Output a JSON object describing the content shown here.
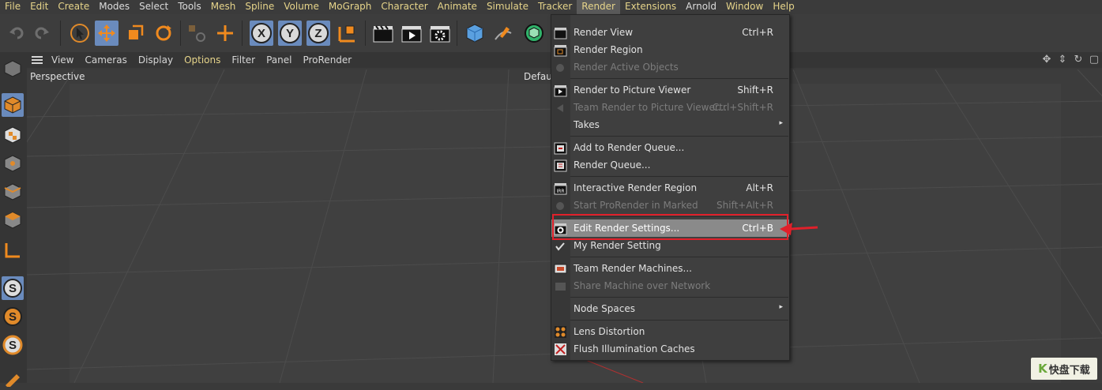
{
  "menubar": {
    "items": [
      {
        "label": "File"
      },
      {
        "label": "Edit"
      },
      {
        "label": "Create"
      },
      {
        "label": "Modes"
      },
      {
        "label": "Select"
      },
      {
        "label": "Tools"
      },
      {
        "label": "Mesh"
      },
      {
        "label": "Spline"
      },
      {
        "label": "Volume"
      },
      {
        "label": "MoGraph"
      },
      {
        "label": "Character"
      },
      {
        "label": "Animate"
      },
      {
        "label": "Simulate"
      },
      {
        "label": "Tracker"
      },
      {
        "label": "Render"
      },
      {
        "label": "Extensions"
      },
      {
        "label": "Arnold"
      },
      {
        "label": "Window"
      },
      {
        "label": "Help"
      }
    ],
    "active": "Render"
  },
  "toolbar": {
    "axis_x": "X",
    "axis_y": "Y",
    "axis_z": "Z"
  },
  "viewport_menu": {
    "items": [
      {
        "label": "View"
      },
      {
        "label": "Cameras"
      },
      {
        "label": "Display"
      },
      {
        "label": "Options"
      },
      {
        "label": "Filter"
      },
      {
        "label": "Panel"
      },
      {
        "label": "ProRender"
      }
    ],
    "highlighted": "Options"
  },
  "viewport": {
    "camera_label": "Perspective",
    "camera_name": "Defaul"
  },
  "render_menu": {
    "items": [
      {
        "label": "Render View",
        "shortcut": "Ctrl+R",
        "icon": "clapper-icon",
        "enabled": true
      },
      {
        "label": "Render Region",
        "shortcut": "",
        "icon": "clapper-region-icon",
        "enabled": true
      },
      {
        "label": "Render Active Objects",
        "shortcut": "",
        "icon": "render-active-icon",
        "enabled": false
      },
      {
        "label": "Render to Picture Viewer",
        "shortcut": "Shift+R",
        "icon": "clapper-play-icon",
        "enabled": true
      },
      {
        "label": "Team Render to Picture Viewer...",
        "shortcut": "Ctrl+Shift+R",
        "icon": "team-render-icon",
        "enabled": false
      },
      {
        "label": "Takes",
        "shortcut": "",
        "icon": "",
        "enabled": true,
        "submenu": true
      },
      {
        "label": "Add to Render Queue...",
        "shortcut": "",
        "icon": "queue-add-icon",
        "enabled": true
      },
      {
        "label": "Render Queue...",
        "shortcut": "",
        "icon": "queue-icon",
        "enabled": true
      },
      {
        "label": "Interactive Render Region",
        "shortcut": "Alt+R",
        "icon": "irr-icon",
        "enabled": true
      },
      {
        "label": "Start ProRender in Marked",
        "shortcut": "Shift+Alt+R",
        "icon": "prorender-icon",
        "enabled": false
      },
      {
        "label": "Edit Render Settings...",
        "shortcut": "Ctrl+B",
        "icon": "render-settings-icon",
        "enabled": true,
        "hovered": true
      },
      {
        "label": "My Render Setting",
        "shortcut": "",
        "icon": "checkmark-icon",
        "enabled": true
      },
      {
        "label": "Team Render Machines...",
        "shortcut": "",
        "icon": "team-machines-icon",
        "enabled": true
      },
      {
        "label": "Share Machine over Network",
        "shortcut": "",
        "icon": "share-network-icon",
        "enabled": false
      },
      {
        "label": "Node Spaces",
        "shortcut": "",
        "icon": "",
        "enabled": true,
        "submenu": true
      },
      {
        "label": "Lens Distortion",
        "shortcut": "",
        "icon": "lens-distortion-icon",
        "enabled": true
      },
      {
        "label": "Flush Illumination Caches",
        "shortcut": "",
        "icon": "flush-cache-icon",
        "enabled": true
      }
    ],
    "submenu_arrow": "▸"
  },
  "watermark": {
    "logo": "K",
    "text": "快盘下载"
  },
  "colors": {
    "menu_text_accent": "#e6d48a",
    "selected_tool": "#6a8bbd",
    "highlight_box": "#e0202a",
    "hover_bg": "#8a8a8a"
  }
}
